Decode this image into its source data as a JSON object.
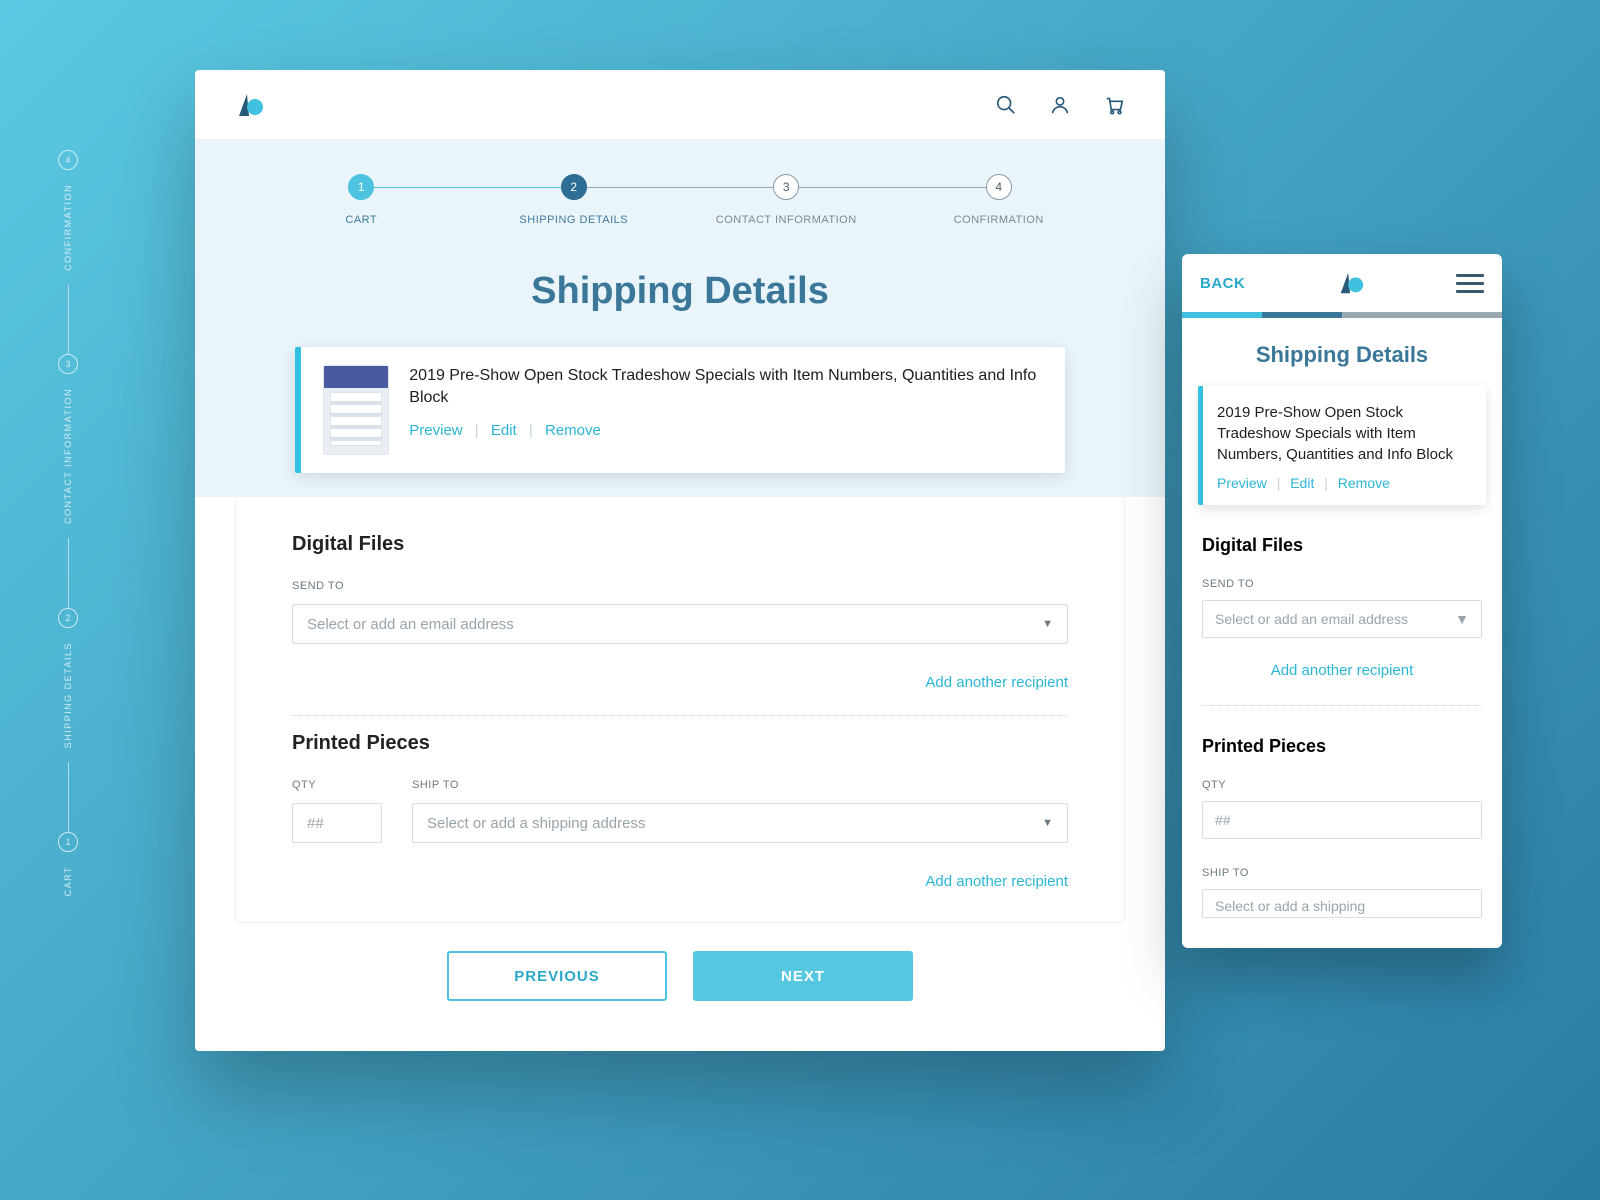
{
  "steps": [
    {
      "num": "1",
      "label": "CART",
      "state": "done"
    },
    {
      "num": "2",
      "label": "SHIPPING DETAILS",
      "state": "active"
    },
    {
      "num": "3",
      "label": "CONTACT INFORMATION",
      "state": "inactive"
    },
    {
      "num": "4",
      "label": "CONFIRMATION",
      "state": "inactive"
    }
  ],
  "page_title": "Shipping Details",
  "item": {
    "title": "2019 Pre-Show Open Stock Tradeshow Specials with Item Numbers, Quantities and Info Block",
    "actions": {
      "preview": "Preview",
      "edit": "Edit",
      "remove": "Remove"
    }
  },
  "digital": {
    "heading": "Digital Files",
    "send_to_label": "SEND TO",
    "email_placeholder": "Select or add an email address",
    "add_recipient": "Add another recipient"
  },
  "printed": {
    "heading": "Printed Pieces",
    "qty_label": "QTY",
    "qty_placeholder": "##",
    "ship_to_label": "SHIP TO",
    "ship_placeholder": "Select or add a shipping address",
    "ship_placeholder_short": "Select or add a shipping",
    "add_recipient": "Add another recipient"
  },
  "buttons": {
    "prev": "PREVIOUS",
    "next": "NEXT"
  },
  "mobile": {
    "back": "BACK"
  }
}
